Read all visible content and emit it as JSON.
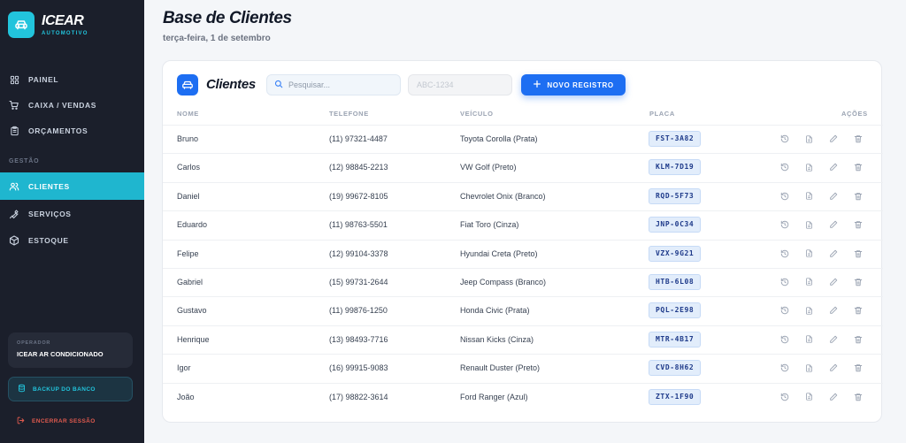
{
  "brand": {
    "name": "ICEAR",
    "subtitle": "AUTOMOTIVO"
  },
  "nav": {
    "items": [
      {
        "label": "PAINEL",
        "icon": "grid-icon"
      },
      {
        "label": "CAIXA / VENDAS",
        "icon": "cart-icon"
      },
      {
        "label": "ORÇAMENTOS",
        "icon": "clipboard-icon"
      }
    ],
    "section_label": "GESTÃO",
    "management": [
      {
        "label": "CLIENTES",
        "icon": "users-icon",
        "active": true
      },
      {
        "label": "SERVIÇOS",
        "icon": "wrench-icon"
      },
      {
        "label": "ESTOQUE",
        "icon": "box-icon"
      }
    ]
  },
  "operator": {
    "label": "OPERADOR",
    "name": "ICEAR AR CONDICIONADO"
  },
  "sidebar_actions": {
    "backup": "BACKUP DO BANCO",
    "logout": "ENCERRAR SESSÃO"
  },
  "header": {
    "title": "Base de Clientes",
    "date": "terça-feira, 1 de setembro"
  },
  "panel": {
    "title": "Clientes",
    "search_placeholder": "Pesquisar...",
    "plate_placeholder": "ABC-1234",
    "new_button": "NOVO REGISTRO",
    "columns": [
      "NOME",
      "TELEFONE",
      "VEÍCULO",
      "PLACA",
      "AÇÕES"
    ],
    "rows": [
      {
        "name": "Bruno",
        "phone": "(11) 97321-4487",
        "vehicle": "Toyota Corolla (Prata)",
        "plate": "FST-3A82"
      },
      {
        "name": "Carlos",
        "phone": "(12) 98845-2213",
        "vehicle": "VW Golf (Preto)",
        "plate": "KLM-7D19"
      },
      {
        "name": "Daniel",
        "phone": "(19) 99672-8105",
        "vehicle": "Chevrolet Onix (Branco)",
        "plate": "RQD-5F73"
      },
      {
        "name": "Eduardo",
        "phone": "(11) 98763-5501",
        "vehicle": "Fiat Toro (Cinza)",
        "plate": "JNP-0C34"
      },
      {
        "name": "Felipe",
        "phone": "(12) 99104-3378",
        "vehicle": "Hyundai Creta (Preto)",
        "plate": "VZX-9G21"
      },
      {
        "name": "Gabriel",
        "phone": "(15) 99731-2644",
        "vehicle": "Jeep Compass (Branco)",
        "plate": "HTB-6L08"
      },
      {
        "name": "Gustavo",
        "phone": "(11) 99876-1250",
        "vehicle": "Honda Civic (Prata)",
        "plate": "PQL-2E98"
      },
      {
        "name": "Henrique",
        "phone": "(13) 98493-7716",
        "vehicle": "Nissan Kicks (Cinza)",
        "plate": "MTR-4B17"
      },
      {
        "name": "Igor",
        "phone": "(16) 99915-9083",
        "vehicle": "Renault Duster (Preto)",
        "plate": "CVD-8H62"
      },
      {
        "name": "João",
        "phone": "(17) 98822-3614",
        "vehicle": "Ford Ranger (Azul)",
        "plate": "ZTX-1F90"
      }
    ],
    "row_actions": [
      "history-icon",
      "document-icon",
      "edit-icon",
      "trash-icon"
    ]
  },
  "colors": {
    "accent": "#1fb6cf",
    "primary": "#1d6ef2",
    "sidebar": "#1b1f2b",
    "danger": "#e05a4e"
  }
}
